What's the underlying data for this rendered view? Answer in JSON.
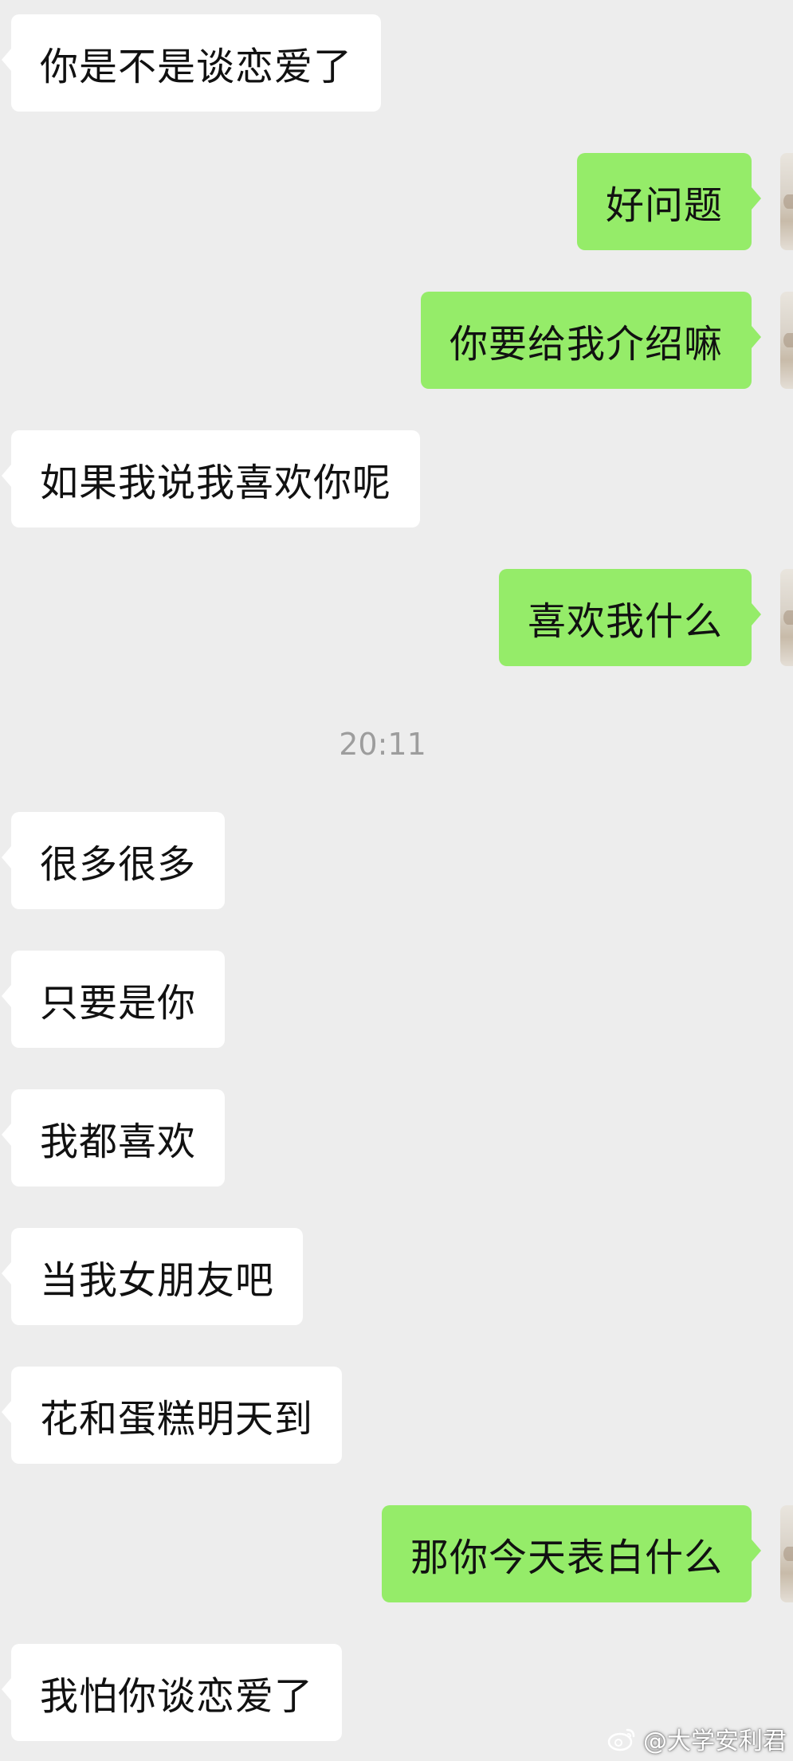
{
  "chat": {
    "messages": [
      {
        "side": "left",
        "text": "你是不是谈恋爱了"
      },
      {
        "side": "right",
        "text": "好问题"
      },
      {
        "side": "right",
        "text": "你要给我介绍嘛"
      },
      {
        "side": "left",
        "text": "如果我说我喜欢你呢"
      },
      {
        "side": "right",
        "text": "喜欢我什么"
      },
      {
        "side": "left",
        "text": "很多很多"
      },
      {
        "side": "left",
        "text": "只要是你"
      },
      {
        "side": "left",
        "text": "我都喜欢"
      },
      {
        "side": "left",
        "text": "当我女朋友吧"
      },
      {
        "side": "left",
        "text": "花和蛋糕明天到"
      },
      {
        "side": "right",
        "text": "那你今天表白什么"
      },
      {
        "side": "left",
        "text": "我怕你谈恋爱了"
      }
    ],
    "timestamp": "20:11"
  },
  "watermark": {
    "text": "@大学安利君",
    "icon": "weibo-logo-icon"
  },
  "colors": {
    "background": "#ededed",
    "incoming_bubble": "#ffffff",
    "outgoing_bubble": "#95ec69",
    "timestamp_text": "#9d9d9d"
  }
}
